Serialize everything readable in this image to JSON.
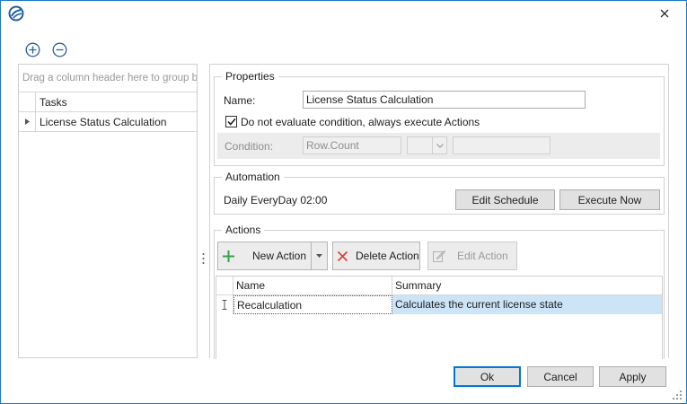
{
  "window": {
    "app_icon": "app-logo-icon",
    "close_icon": "close-icon",
    "accent": "#1979ca"
  },
  "toolbar": {
    "add_icon": "plus-circle-icon",
    "remove_icon": "minus-circle-icon"
  },
  "tasks_grid": {
    "group_panel_hint": "Drag a column header here to group by",
    "column_header": "Tasks",
    "rows": [
      {
        "label": "License Status Calculation"
      }
    ]
  },
  "properties": {
    "legend": "Properties",
    "name_label": "Name:",
    "name_value": "License Status Calculation",
    "checkbox_label": "Do not evaluate condition, always execute Actions",
    "checkbox_checked": true,
    "condition_label": "Condition:",
    "condition_value": "Row.Count",
    "condition_operator": "",
    "condition_operand": ""
  },
  "automation": {
    "legend": "Automation",
    "schedule_text": "Daily EveryDay 02:00",
    "edit_schedule_label": "Edit Schedule",
    "execute_now_label": "Execute Now"
  },
  "actions": {
    "legend": "Actions",
    "new_action_label": "New Action",
    "delete_action_label": "Delete Action",
    "edit_action_label": "Edit Action",
    "columns": [
      "Name",
      "Summary"
    ],
    "rows": [
      {
        "name": "Recalculation",
        "summary": "Calculates the current license state"
      }
    ],
    "selection_color": "#cce4f7"
  },
  "footer": {
    "ok_label": "Ok",
    "cancel_label": "Cancel",
    "apply_label": "Apply"
  }
}
